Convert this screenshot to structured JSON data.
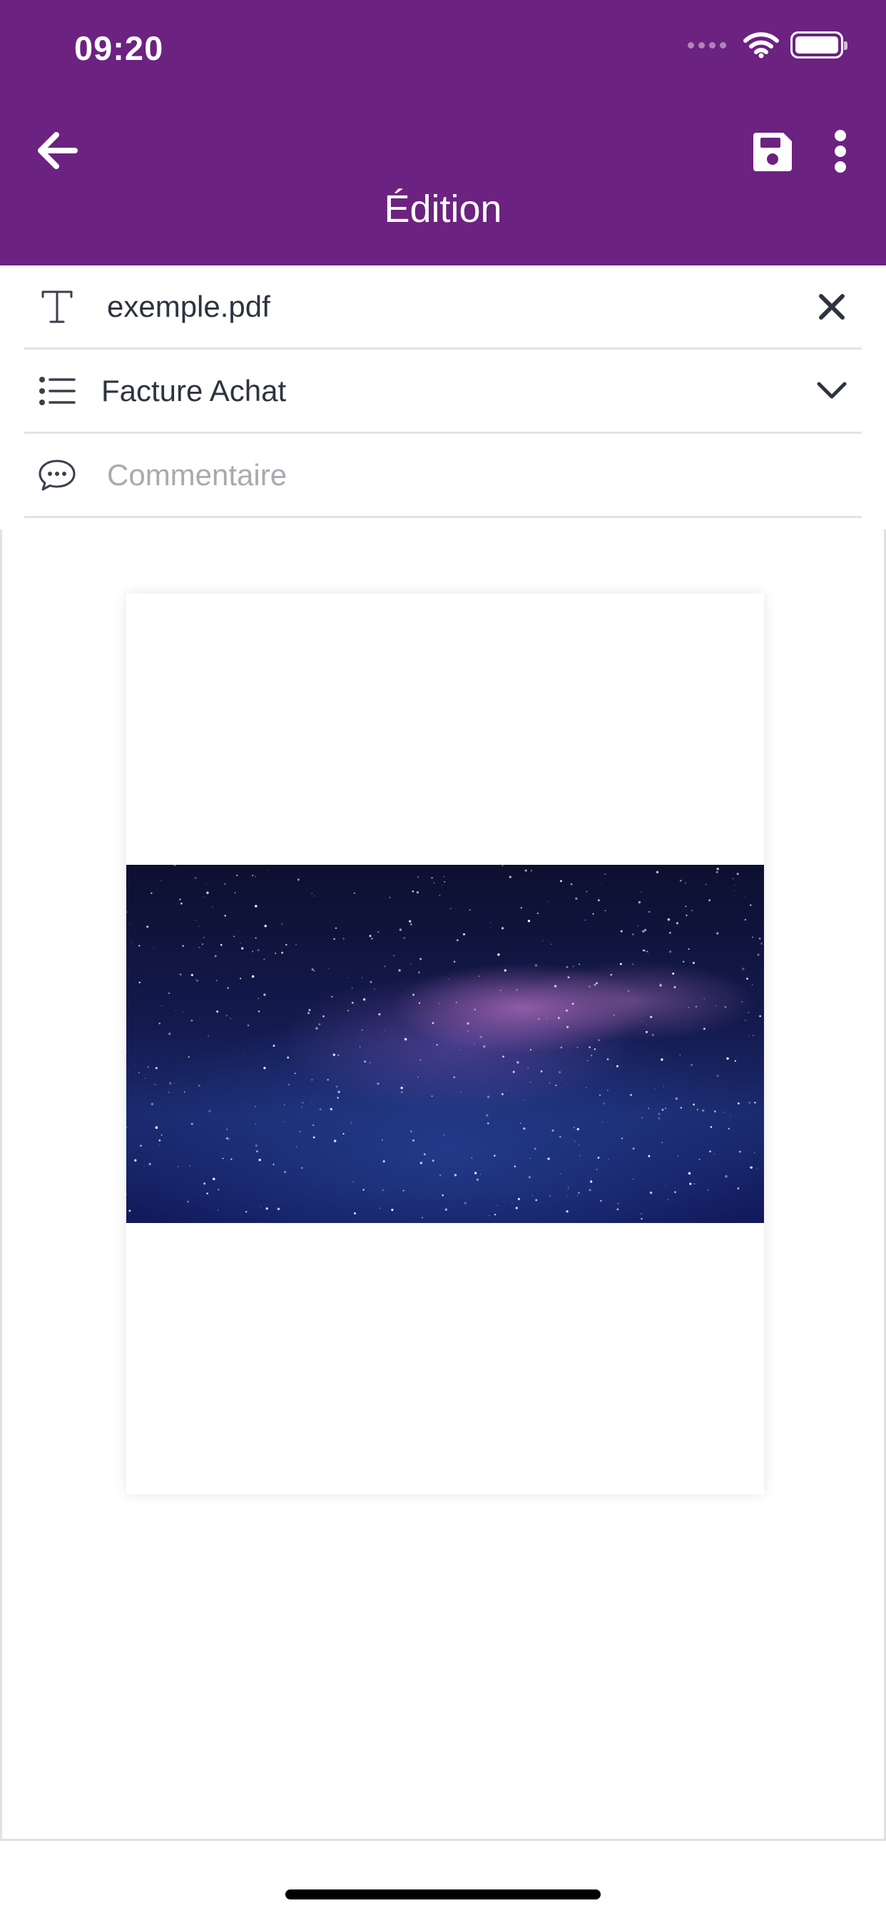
{
  "status_bar": {
    "time": "09:20"
  },
  "header": {
    "title": "Édition",
    "background": "#6c2280"
  },
  "form": {
    "filename": "exemple.pdf",
    "category": "Facture Achat",
    "comment_placeholder": "Commentaire"
  },
  "icons": {
    "back": "arrow-left-icon",
    "save": "floppy-disk-icon",
    "more": "vertical-ellipsis-icon",
    "filename": "text-t-icon",
    "clear": "close-icon",
    "category": "list-icon",
    "dropdown": "chevron-down-icon",
    "comment": "speech-bubble-icon"
  }
}
